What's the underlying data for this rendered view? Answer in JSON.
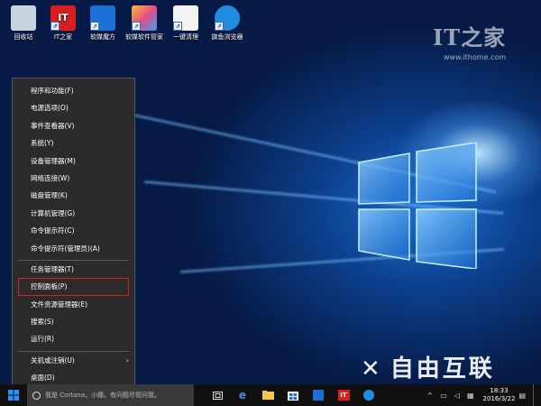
{
  "desktop_icons": [
    {
      "label": "回收站",
      "icon": "recycle-bin-icon",
      "color": "#c7d3de"
    },
    {
      "label": "IT之家",
      "icon": "ithome-app-icon",
      "color": "#d81e1e"
    },
    {
      "label": "软媒魔方",
      "icon": "ruanmei-mofang-icon",
      "color": "#1d6fd8"
    },
    {
      "label": "软媒软件管家",
      "icon": "ruanmei-software-manager-icon",
      "color": "#e84b8a"
    },
    {
      "label": "一键清理",
      "icon": "one-click-clean-icon",
      "color": "#f2f2f2"
    },
    {
      "label": "旗鱼浏览器",
      "icon": "qiyu-browser-icon",
      "color": "#1f8ce0"
    }
  ],
  "watermark": {
    "logo": "IT之家",
    "url": "www.ithome.com"
  },
  "context_menu": {
    "group1": [
      "程序和功能(F)",
      "电源选项(O)",
      "事件查看器(V)",
      "系统(Y)",
      "设备管理器(M)",
      "网络连接(W)",
      "磁盘管理(K)",
      "计算机管理(G)",
      "命令提示符(C)",
      "命令提示符(管理员)(A)"
    ],
    "group2": [
      "任务管理器(T)",
      "控制面板(P)",
      "文件资源管理器(E)",
      "搜索(S)",
      "运行(R)"
    ],
    "group3": [
      "关机或注销(U)",
      "桌面(D)"
    ],
    "highlighted": "控制面板(P)",
    "highlight_color": "#d92020"
  },
  "bottom_watermark": {
    "text": "自由互联"
  },
  "taskbar": {
    "search_placeholder": "我是 Cortana，小娜。有问题尽管问我。",
    "pinned": [
      "task-view-icon",
      "edge-browser-icon",
      "file-explorer-icon",
      "store-icon",
      "ruanmei-mofang-icon",
      "ithome-app-icon",
      "qiyu-browser-icon"
    ],
    "tray": {
      "chevron": "^",
      "time": "18:33",
      "date": "2016/3/22"
    }
  }
}
